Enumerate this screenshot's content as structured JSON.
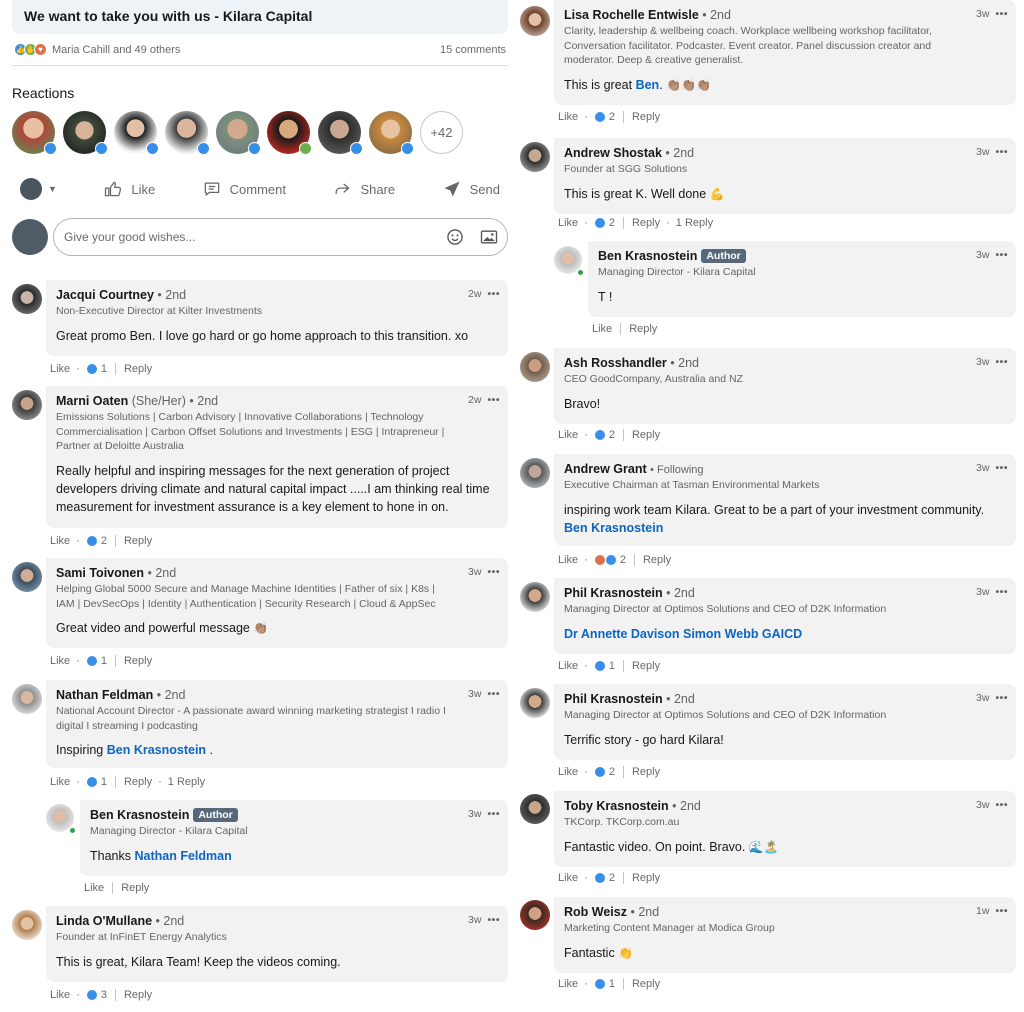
{
  "post": {
    "title": "We want to take you with us - Kilara Capital",
    "reactors_text": "Maria Cahill and 49 others",
    "comments_count": "15 comments",
    "reactions_heading": "Reactions",
    "more_reactors": "+42"
  },
  "actions": {
    "like": "Like",
    "comment": "Comment",
    "share": "Share",
    "send": "Send"
  },
  "composer": {
    "placeholder": "Give your good wishes..."
  },
  "left_comments": [
    {
      "name": "Jacqui Courtney",
      "degree": "• 2nd",
      "time": "2w",
      "headline": "Non-Executive Director at Kilter Investments",
      "body": "Great promo Ben. I love go hard or go home approach to this transition. xo",
      "likes": "1",
      "like_label": "Like",
      "reply_label": "Reply"
    },
    {
      "name": "Marni Oaten",
      "pronouns": "(She/Her)",
      "degree": "• 2nd",
      "time": "2w",
      "headline": "Emissions Solutions | Carbon Advisory | Innovative Collaborations | Technology Commercialisation | Carbon Offset Solutions and Investments | ESG | Intrapreneur | Partner at Deloitte Australia",
      "body": "Really helpful and inspiring messages for the next generation of project developers driving climate and natural capital impact .....I am thinking real time measurement for investment assurance is a key element to hone in on.",
      "likes": "2",
      "like_label": "Like",
      "reply_label": "Reply"
    },
    {
      "name": "Sami Toivonen",
      "degree": "• 2nd",
      "time": "3w",
      "headline": "Helping Global 5000 Secure and Manage Machine Identities | Father of six | K8s | IAM | DevSecOps | Identity | Authentication | Security Research | Cloud & AppSec",
      "body": "Great video and powerful message",
      "emoji": "👏🏽",
      "likes": "1",
      "like_label": "Like",
      "reply_label": "Reply"
    },
    {
      "name": "Nathan Feldman",
      "degree": "• 2nd",
      "time": "3w",
      "headline": "National Account Director - A passionate award winning marketing strategist I radio I digital I streaming I podcasting",
      "body": "Inspiring",
      "mention": "Ben Krasnostein",
      "body_after": " .",
      "likes": "1",
      "like_label": "Like",
      "reply_label": "Reply",
      "replies": "1 Reply"
    },
    {
      "name": "Ben Krasnostein",
      "badge": "Author",
      "time": "3w",
      "headline": "Managing Director - Kilara Capital",
      "body": "Thanks",
      "mention": "Nathan Feldman",
      "like_label": "Like",
      "reply_label": "Reply"
    },
    {
      "name": "Linda O'Mullane",
      "degree": "• 2nd",
      "time": "3w",
      "headline": "Founder at InFinET Energy Analytics",
      "body": "This is great, Kilara Team! Keep the videos coming.",
      "likes": "3",
      "like_label": "Like",
      "reply_label": "Reply"
    }
  ],
  "right_comments": [
    {
      "name": "Lisa Rochelle Entwisle",
      "degree": "• 2nd",
      "time": "3w",
      "headline": "Clarity, leadership & wellbeing coach. Workplace wellbeing workshop facilitator, Conversation facilitator. Podcaster. Event creator. Panel discussion creator and moderator. Deep & creative generalist.",
      "body": "This is great",
      "mention": "Ben",
      "emoji": "👏🏽👏🏽👏🏽",
      "likes": "2",
      "like_label": "Like",
      "reply_label": "Reply"
    },
    {
      "name": "Andrew Shostak",
      "degree": "• 2nd",
      "time": "3w",
      "headline": "Founder at SGG Solutions",
      "body": "This is great K. Well done",
      "emoji": "💪",
      "likes": "2",
      "like_label": "Like",
      "reply_label": "Reply",
      "replies": "1 Reply"
    },
    {
      "name": "Ben Krasnostein",
      "badge": "Author",
      "time": "3w",
      "headline": "Managing Director - Kilara Capital",
      "body": "T !",
      "like_label": "Like",
      "reply_label": "Reply"
    },
    {
      "name": "Ash Rosshandler",
      "degree": "• 2nd",
      "time": "3w",
      "headline": "CEO GoodCompany, Australia and NZ",
      "body": "Bravo!",
      "likes": "2",
      "like_label": "Like",
      "reply_label": "Reply"
    },
    {
      "name": "Andrew Grant",
      "degree": "• Following",
      "time": "3w",
      "headline": "Executive Chairman at Tasman Environmental Markets",
      "body": "inspiring work team Kilara. Great to be a part of your investment community.",
      "mention": "Ben Krasnostein",
      "likes": "2",
      "like_label": "Like",
      "reply_label": "Reply"
    },
    {
      "name": "Phil Krasnostein",
      "degree": "• 2nd",
      "time": "3w",
      "headline": "Managing Director at Optimos Solutions and CEO of D2K Information",
      "mention": "Dr Annette Davison Simon Webb GAICD",
      "likes": "1",
      "like_label": "Like",
      "reply_label": "Reply"
    },
    {
      "name": "Phil Krasnostein",
      "degree": "• 2nd",
      "time": "3w",
      "headline": "Managing Director at Optimos Solutions and CEO of D2K Information",
      "body": "Terrific story - go hard Kilara!",
      "likes": "2",
      "like_label": "Like",
      "reply_label": "Reply"
    },
    {
      "name": "Toby Krasnostein",
      "degree": "• 2nd",
      "time": "3w",
      "headline": "TKCorp. TKCorp.com.au",
      "body": "Fantastic video. On point. Bravo.",
      "emoji": "🌊🏝️",
      "likes": "2",
      "like_label": "Like",
      "reply_label": "Reply"
    },
    {
      "name": "Rob Weisz",
      "degree": "• 2nd",
      "time": "1w",
      "headline": "Marketing Content Manager at Modica Group",
      "body": "Fantastic",
      "emoji": "👏",
      "likes": "1",
      "like_label": "Like",
      "reply_label": "Reply"
    }
  ],
  "colors": {
    "bubble": "#f2f2f2",
    "mention": "#0a66c2",
    "like": "#378fe9",
    "author_badge": "#56687a"
  }
}
